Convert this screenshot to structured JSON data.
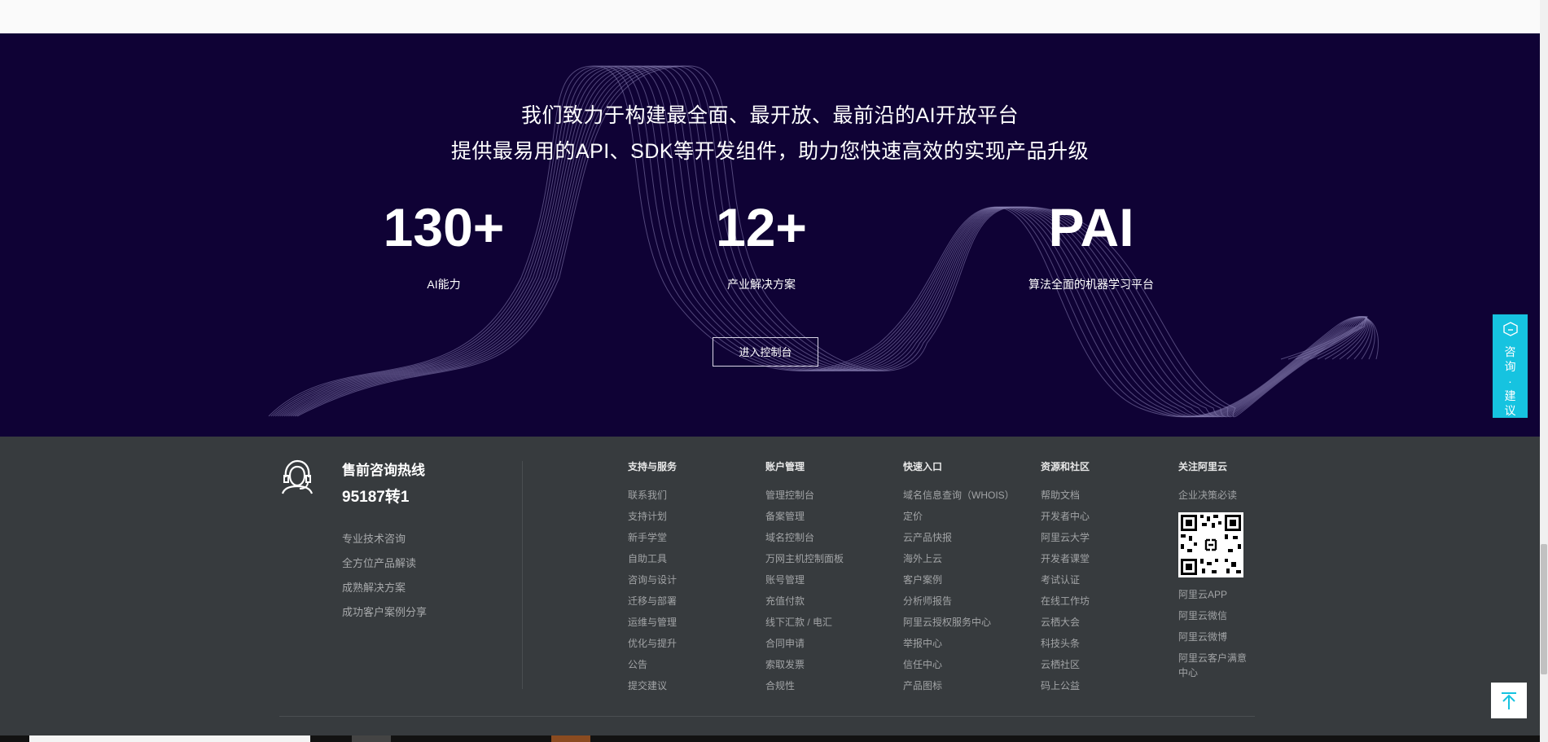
{
  "hero": {
    "line1": "我们致力于构建最全面、最开放、最前沿的AI开放平台",
    "line2": "提供最易用的API、SDK等开发组件，助力您快速高效的实现产品升级",
    "stats": [
      {
        "value": "130+",
        "label": "AI能力"
      },
      {
        "value": "12+",
        "label": "产业解决方案"
      },
      {
        "value": "PAI",
        "label": "算法全面的机器学习平台"
      }
    ],
    "console_button": "进入控制台"
  },
  "side_widget": {
    "label": "咨询·建议",
    "icon": "chat-bubble-icon"
  },
  "footer": {
    "hotline": {
      "icon": "customer-service-icon",
      "title": "售前咨询热线",
      "number": "95187转1",
      "links": [
        "专业技术咨询",
        "全方位产品解读",
        "成熟解决方案",
        "成功客户案例分享"
      ]
    },
    "columns": [
      {
        "title": "支持与服务",
        "items": [
          "联系我们",
          "支持计划",
          "新手学堂",
          "自助工具",
          "咨询与设计",
          "迁移与部署",
          "运维与管理",
          "优化与提升",
          "公告",
          "提交建议"
        ]
      },
      {
        "title": "账户管理",
        "items": [
          "管理控制台",
          "备案管理",
          "域名控制台",
          "万网主机控制面板",
          "账号管理",
          "充值付款",
          "线下汇款 / 电汇",
          "合同申请",
          "索取发票",
          "合规性"
        ]
      },
      {
        "title": "快速入口",
        "items": [
          "域名信息查询（WHOIS）",
          "定价",
          "云产品快报",
          "海外上云",
          "客户案例",
          "分析师报告",
          "阿里云授权服务中心",
          "举报中心",
          "信任中心",
          "产品图标"
        ]
      },
      {
        "title": "资源和社区",
        "items": [
          "帮助文档",
          "开发者中心",
          "阿里云大学",
          "开发者课堂",
          "考试认证",
          "在线工作坊",
          "云栖大会",
          "科技头条",
          "云栖社区",
          "码上公益"
        ]
      }
    ],
    "follow": {
      "title": "关注阿里云",
      "subtitle": "企业决策必读",
      "qr_icon": "qr-code-icon",
      "items": [
        "阿里云APP",
        "阿里云微信",
        "阿里云微博",
        "阿里云客户满意中心"
      ]
    }
  },
  "back_to_top": {
    "icon": "arrow-up-icon"
  },
  "colors": {
    "hero_bg": "#0f0235",
    "footer_bg": "#373b3e",
    "accent": "#16c3e0"
  }
}
